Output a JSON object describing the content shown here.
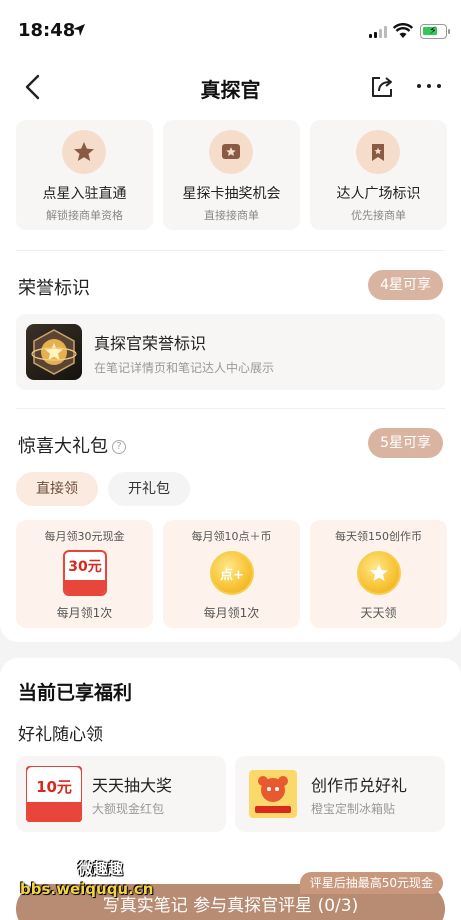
{
  "status_bar": {
    "time": "18:48"
  },
  "nav": {
    "title": "真探官"
  },
  "perks": [
    {
      "title": "点星入驻直通",
      "sub": "解锁接商单资格",
      "icon": "star-icon"
    },
    {
      "title": "星探卡抽奖机会",
      "sub": "直接接商单",
      "icon": "card-icon"
    },
    {
      "title": "达人广场标识",
      "sub": "优先接商单",
      "icon": "bookmark-icon"
    }
  ],
  "honor": {
    "title": "荣誉标识",
    "badge": "4星可享",
    "item_title": "真探官荣誉标识",
    "item_sub": "在笔记详情页和笔记达人中心展示"
  },
  "gift_pack": {
    "title": "惊喜大礼包",
    "badge": "5星可享",
    "tabs": [
      "直接领",
      "开礼包"
    ],
    "items": [
      {
        "top": "每月领30元现金",
        "visual": "30元",
        "bottom": "每月领1次"
      },
      {
        "top": "每月领10点＋币",
        "visual": "点+",
        "bottom": "每月领1次"
      },
      {
        "top": "每天领150创作币",
        "visual": "",
        "bottom": "天天领"
      }
    ]
  },
  "current": {
    "title": "当前已享福利",
    "subtitle": "好礼随心领",
    "benefits": [
      {
        "title": "天天抽大奖",
        "sub": "大额现金红包",
        "visual": "10元"
      },
      {
        "title": "创作币兑好礼",
        "sub": "橙宝定制冰箱贴",
        "visual": ""
      }
    ]
  },
  "cta": {
    "tip": "评星后抽最高50元现金",
    "label": "写真实笔记 参与真探官评星 (0/3)"
  },
  "watermark": {
    "line1": "微趣趣",
    "line2": "bbs.weiququ.cn"
  },
  "colors": {
    "accent": "#b88b73",
    "badge": "#d9b5a1",
    "red": "#e8453b"
  }
}
